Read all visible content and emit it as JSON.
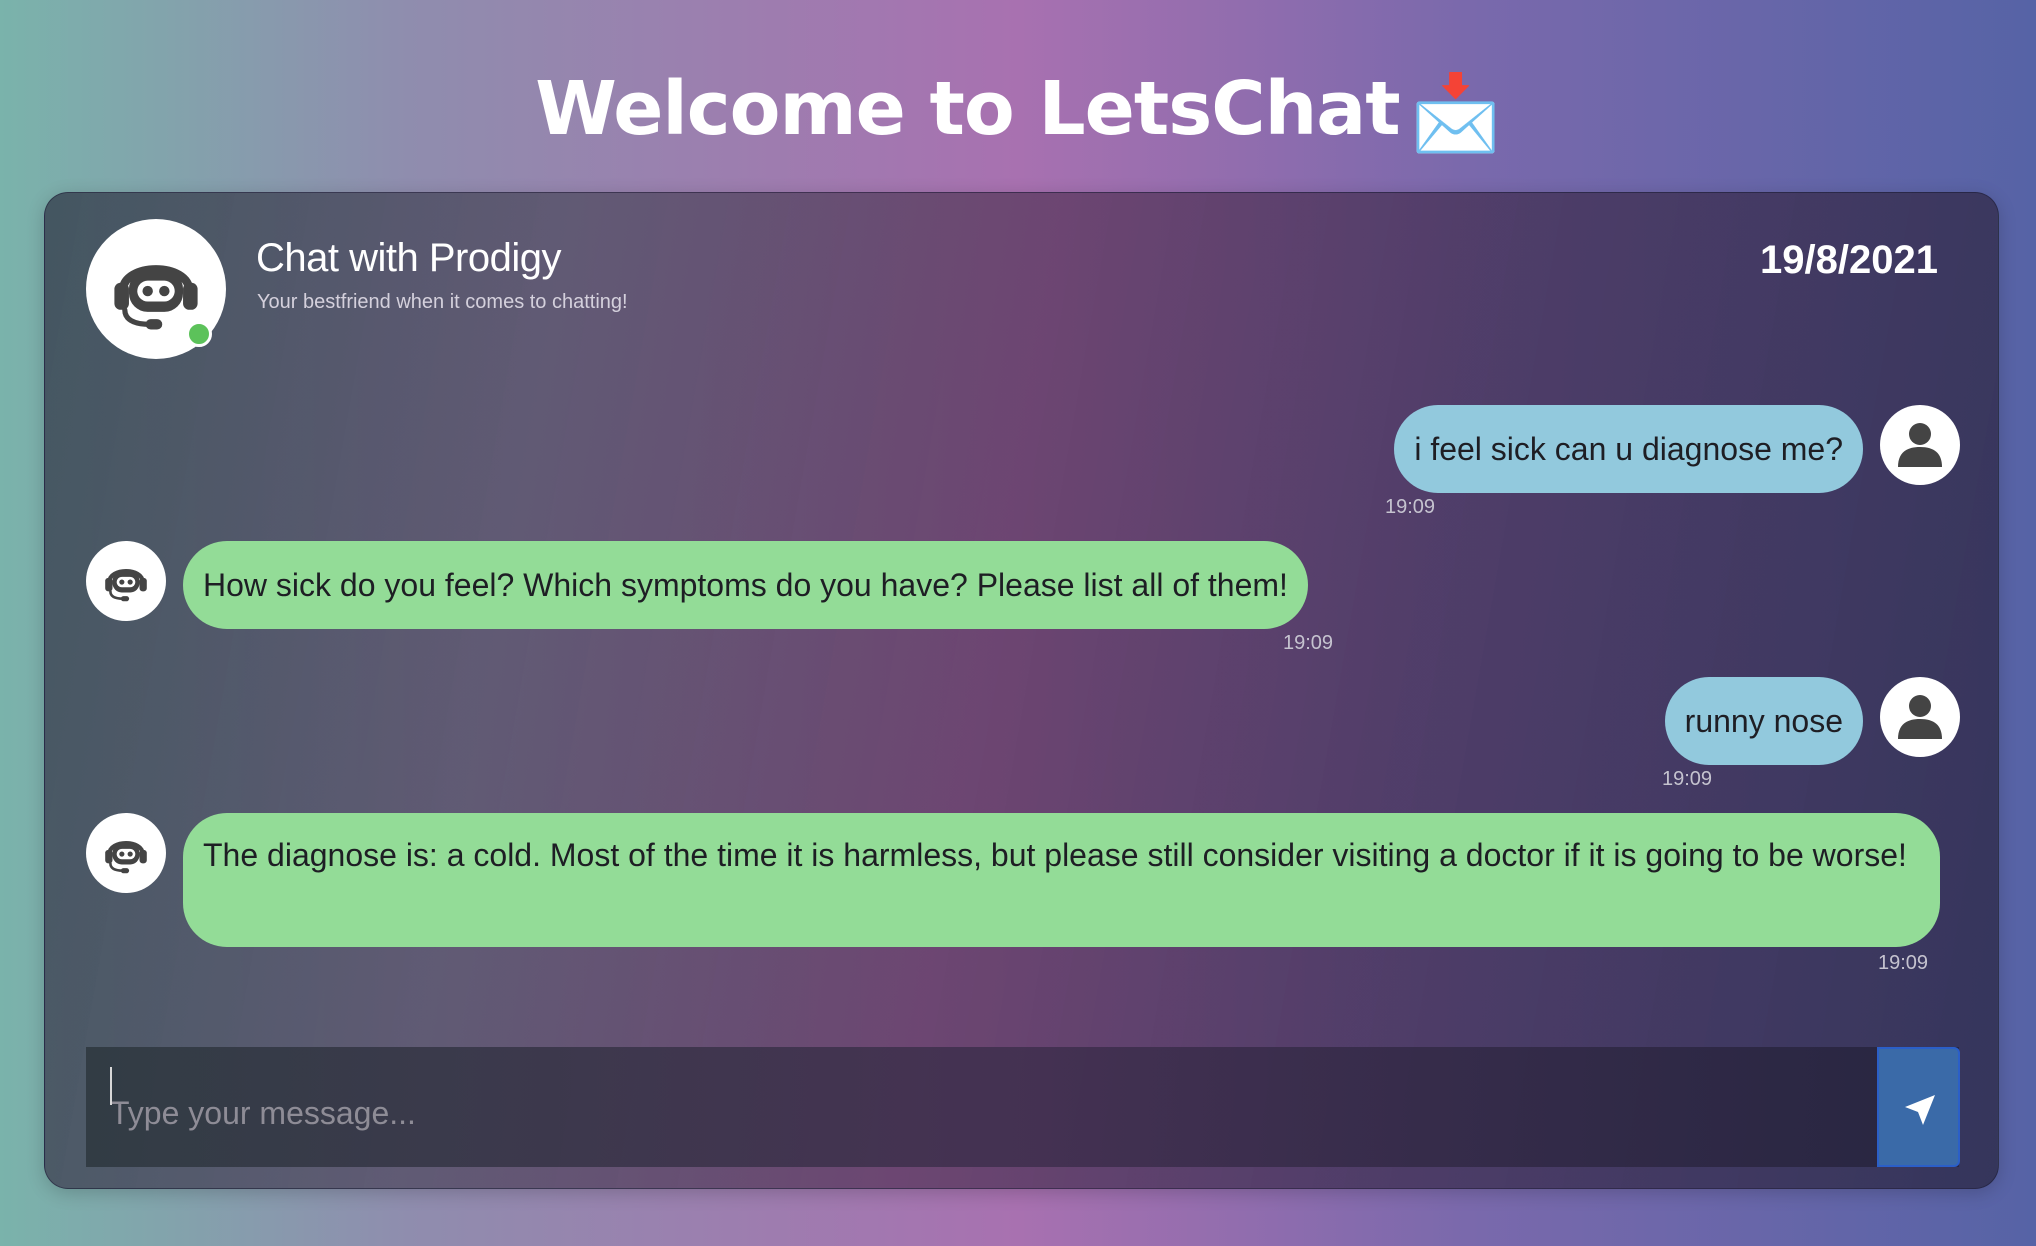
{
  "page": {
    "title": "Welcome to LetsChat",
    "title_emoji": "📩"
  },
  "chat": {
    "bot_name": "Chat with Prodigy",
    "bot_subtitle": "Your bestfriend when it comes to chatting!",
    "date": "19/8/2021",
    "online_status_color": "#5cc25a"
  },
  "messages": [
    {
      "sender": "user",
      "text": "i feel sick can u diagnose me?",
      "time": "19:09"
    },
    {
      "sender": "bot",
      "text": "How sick do you feel? Which symptoms do you have? Please list all of them!",
      "time": "19:09"
    },
    {
      "sender": "user",
      "text": "runny nose",
      "time": "19:09"
    },
    {
      "sender": "bot",
      "text": "The diagnose is: a cold. Most of the time it is harmless, but please still consider visiting a doctor if it is going to be worse!",
      "time": "19:09"
    }
  ],
  "input": {
    "placeholder": "Type your message...",
    "value": ""
  },
  "colors": {
    "user_bubble": "#92c9dd",
    "bot_bubble": "#93dc97",
    "send_button": "#3a6aa8"
  },
  "icons": {
    "bot_avatar": "robot-headset-icon",
    "user_avatar": "user-icon",
    "send": "paper-plane-icon"
  }
}
